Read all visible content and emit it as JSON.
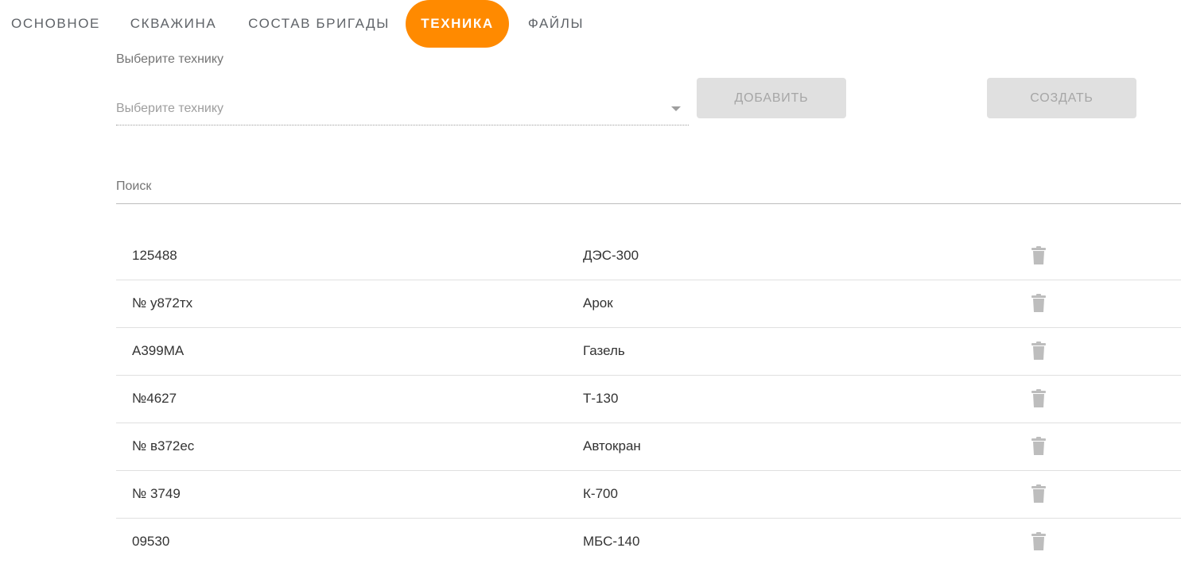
{
  "tabs": [
    {
      "label": "Основное",
      "active": false
    },
    {
      "label": "Скважина",
      "active": false
    },
    {
      "label": "Состав бригады",
      "active": false
    },
    {
      "label": "Техника",
      "active": true
    },
    {
      "label": "Файлы",
      "active": false
    }
  ],
  "equipment_select": {
    "label": "Выберите технику",
    "placeholder": "Выберите технику"
  },
  "buttons": {
    "add_label": "Добавить",
    "create_label": "Создать"
  },
  "search": {
    "placeholder": "Поиск"
  },
  "colors": {
    "accent": "#ff8a00",
    "button_disabled_bg": "#e0e0e0",
    "icon_gray": "#bdbdbd"
  },
  "equipment_list": [
    {
      "number": "125488",
      "name": "ДЭС-300"
    },
    {
      "number": "№ у872тх",
      "name": "Арок"
    },
    {
      "number": "А399МА",
      "name": "Газель"
    },
    {
      "number": "№4627",
      "name": "Т-130"
    },
    {
      "number": "№ в372ес",
      "name": "Автокран"
    },
    {
      "number": "№ 3749",
      "name": "К-700"
    },
    {
      "number": "09530",
      "name": "МБС-140"
    }
  ]
}
